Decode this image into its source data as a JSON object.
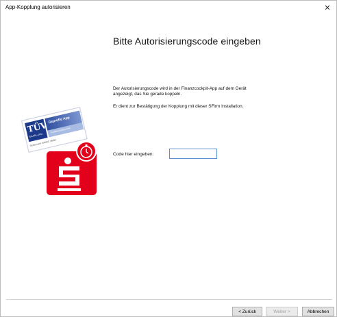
{
  "window": {
    "title": "App-Kopplung autorisieren",
    "close_glyph": "✕"
  },
  "main": {
    "heading": "Bitte Autorisierungscode eingeben",
    "paragraph_1": "Der Autorisierungscode wird in der Finanzcockpit-App auf dem Gerät angezeigt, das Sie gerade koppeln.",
    "paragraph_2": "Er dient zur Bestätigung der Kopplung mit dieser SFirm Installation.",
    "code_label": "Code hier eingeben:",
    "code_value": ""
  },
  "logo": {
    "seal_text": "TÜV",
    "seal_sub": "SAARLAND",
    "band_title": "Geprüfte App",
    "band_sub": "Funktionssicherheit",
    "footer": "Sicher nach ISO/IEC 25051",
    "icons": [
      "tuev-seal-icon",
      "sparkasse-s-icon",
      "stopwatch-icon"
    ],
    "colors": {
      "sparkasse_red": "#e2001a",
      "tuev_blue": "#1d3a8a"
    }
  },
  "buttons": {
    "back": "< Zurück",
    "next": "Weiter >",
    "cancel": "Abbrechen",
    "next_disabled": true
  }
}
